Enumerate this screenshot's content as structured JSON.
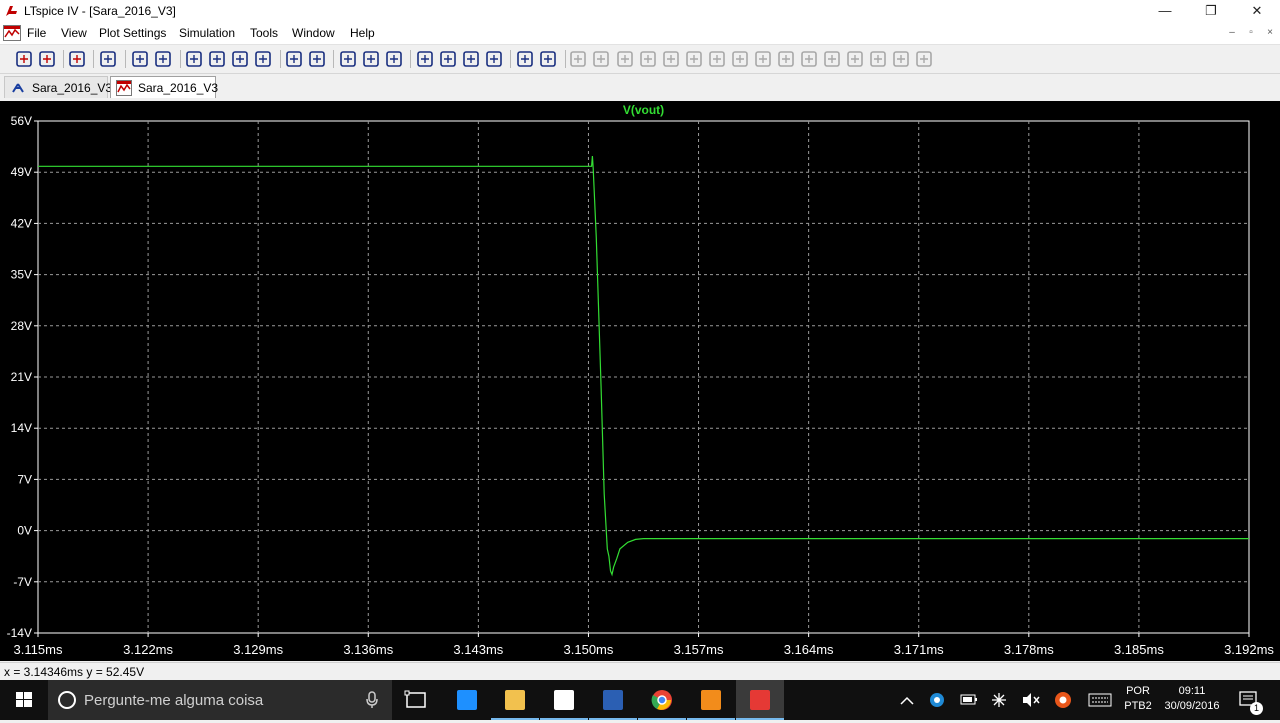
{
  "window": {
    "title": "LTspice IV - [Sara_2016_V3]",
    "minimize_glyph": "—",
    "maximize_glyph": "❐",
    "close_glyph": "✕"
  },
  "menu": {
    "items": [
      "File",
      "View",
      "Plot Settings",
      "Simulation",
      "Tools",
      "Window",
      "Help"
    ],
    "mdi_min": "–",
    "mdi_restore": "▫",
    "mdi_close": "×"
  },
  "toolbar": {
    "icons": [
      "new-schematic-icon",
      "open-icon",
      "save-icon",
      "control-panel-icon",
      "run-icon",
      "pan-hand-icon",
      "zoom-in-icon",
      "zoom-area-icon",
      "zoom-out-icon",
      "zoom-cancel-icon",
      "autorange-icon",
      "zoom-fit-icon",
      "tile-horizontal-icon",
      "cascade-icon",
      "tile-vertical-icon",
      "cut-icon",
      "copy-icon",
      "paste-icon",
      "find-icon",
      "print-setup-icon",
      "print-icon",
      "wire-icon",
      "ground-icon",
      "label-net-icon",
      "resistor-icon",
      "capacitor-icon",
      "inductor-icon",
      "diode-icon",
      "component-icon",
      "move-icon",
      "drag-icon",
      "undo-icon",
      "redo-icon",
      "rotate-icon",
      "mirror-icon",
      "text-icon",
      "spice-directive-icon"
    ]
  },
  "tabs": [
    {
      "label": "Sara_2016_V3",
      "icon": "schematic-icon",
      "active": false
    },
    {
      "label": "Sara_2016_V3",
      "icon": "waveform-icon",
      "active": true
    }
  ],
  "colors": {
    "trace": "#33dd33",
    "grid": "#9a9a9a",
    "axis_text": "#ffffff",
    "plot_bg": "#000000"
  },
  "chart_data": {
    "type": "line",
    "title": "V(vout)",
    "xlabel": "",
    "ylabel": "",
    "xlim": [
      3.115,
      3.192
    ],
    "ylim": [
      -14,
      56
    ],
    "x_ticks": [
      "3.115ms",
      "3.122ms",
      "3.129ms",
      "3.136ms",
      "3.143ms",
      "3.150ms",
      "3.157ms",
      "3.164ms",
      "3.171ms",
      "3.178ms",
      "3.185ms",
      "3.192ms"
    ],
    "y_ticks": [
      "56V",
      "49V",
      "42V",
      "35V",
      "28V",
      "21V",
      "14V",
      "7V",
      "0V",
      "-7V",
      "-14V"
    ],
    "grid": true,
    "series": [
      {
        "name": "V(vout)",
        "x": [
          3.115,
          3.1502,
          3.15025,
          3.1503,
          3.1505,
          3.1508,
          3.151,
          3.1512,
          3.1513,
          3.1514,
          3.1515,
          3.1516,
          3.1518,
          3.152,
          3.1525,
          3.153,
          3.1535,
          3.192
        ],
        "y": [
          49.8,
          49.8,
          51.2,
          49.5,
          40.0,
          20.0,
          5.0,
          -2.5,
          -3.5,
          -5.5,
          -6.0,
          -5.0,
          -3.8,
          -2.5,
          -1.6,
          -1.2,
          -1.1,
          -1.1
        ]
      }
    ]
  },
  "status": {
    "cursor_readout": "x = 3.14346ms   y = 52.45V"
  },
  "taskbar": {
    "search_placeholder": "Pergunte-me alguma coisa",
    "apps": [
      "task-view-icon",
      "edge-icon",
      "file-explorer-icon",
      "store-icon",
      "word-icon",
      "chrome-icon",
      "matlab-icon",
      "ltspice-icon"
    ],
    "language_top": "POR",
    "language_bottom": "PTB2",
    "time": "09:11",
    "date": "30/09/2016",
    "notification_count": "1"
  }
}
